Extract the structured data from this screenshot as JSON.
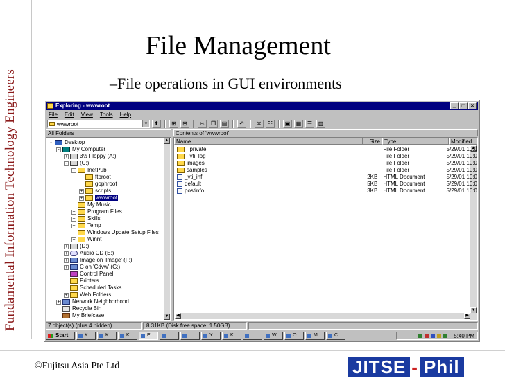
{
  "slide": {
    "title": "File Management",
    "bullet_marker": "–",
    "bullet": "File operations in GUI environments",
    "side_label": "Fundamental Information Technology Engineers",
    "footer_copyright": "©Fujitsu Asia Pte Ltd",
    "logo_left": "JITSE",
    "logo_dash": "-",
    "logo_right": "Phil"
  },
  "window": {
    "title": "Exploring - wwwroot",
    "buttons": {
      "minimize": "_",
      "maximize": "□",
      "close": "×"
    },
    "menu": [
      "File",
      "Edit",
      "View",
      "Tools",
      "Help"
    ],
    "address": "wwwroot",
    "toolbar_icons": [
      "up-folder-icon",
      "map-drive-icon",
      "disconnect-icon",
      "cut-icon",
      "copy-icon",
      "paste-icon",
      "undo-icon",
      "delete-icon",
      "properties-icon",
      "large-icons-icon",
      "small-icons-icon",
      "list-icon",
      "details-icon"
    ],
    "pane_left_header": "All Folders",
    "pane_right_header": "Contents of 'wwwroot'",
    "tree": [
      {
        "label": "Desktop",
        "icon": "desk",
        "toggle": "-",
        "depth": 0
      },
      {
        "label": "My Computer",
        "icon": "comp",
        "toggle": "-",
        "depth": 1
      },
      {
        "label": "3½ Floppy (A:)",
        "icon": "drive",
        "toggle": "+",
        "depth": 2
      },
      {
        "label": "(C:)",
        "icon": "drive",
        "toggle": "-",
        "depth": 2
      },
      {
        "label": "InetPub",
        "icon": "folder",
        "toggle": "-",
        "depth": 3
      },
      {
        "label": "ftproot",
        "icon": "folder",
        "toggle": "",
        "depth": 4
      },
      {
        "label": "gophroot",
        "icon": "folder",
        "toggle": "",
        "depth": 4
      },
      {
        "label": "scripts",
        "icon": "folder",
        "toggle": "+",
        "depth": 4
      },
      {
        "label": "wwwroot",
        "icon": "folder",
        "toggle": "+",
        "depth": 4,
        "selected": true
      },
      {
        "label": "My Music",
        "icon": "folder",
        "toggle": "",
        "depth": 3
      },
      {
        "label": "Program Files",
        "icon": "folder",
        "toggle": "+",
        "depth": 3
      },
      {
        "label": "Skills",
        "icon": "folder",
        "toggle": "+",
        "depth": 3
      },
      {
        "label": "Temp",
        "icon": "folder",
        "toggle": "+",
        "depth": 3
      },
      {
        "label": "Windows Update Setup Files",
        "icon": "folder",
        "toggle": "",
        "depth": 3
      },
      {
        "label": "Winnt",
        "icon": "folder",
        "toggle": "+",
        "depth": 3
      },
      {
        "label": "(D:)",
        "icon": "drive",
        "toggle": "+",
        "depth": 2
      },
      {
        "label": "Audio CD (E:)",
        "icon": "cd",
        "toggle": "+",
        "depth": 2
      },
      {
        "label": "Image on 'Image' (F:)",
        "icon": "net",
        "toggle": "+",
        "depth": 2
      },
      {
        "label": "C on 'Cdvw' (G:)",
        "icon": "net",
        "toggle": "+",
        "depth": 2
      },
      {
        "label": "Control Panel",
        "icon": "cpl",
        "toggle": "",
        "depth": 2
      },
      {
        "label": "Printers",
        "icon": "folder",
        "toggle": "",
        "depth": 2
      },
      {
        "label": "Scheduled Tasks",
        "icon": "folder",
        "toggle": "",
        "depth": 2
      },
      {
        "label": "Web Folders",
        "icon": "folder",
        "toggle": "+",
        "depth": 2
      },
      {
        "label": "Network Neighborhood",
        "icon": "net",
        "toggle": "+",
        "depth": 1
      },
      {
        "label": "Recycle Bin",
        "icon": "bin",
        "toggle": "",
        "depth": 1
      },
      {
        "label": "My Briefcase",
        "icon": "brief",
        "toggle": "",
        "depth": 1
      }
    ],
    "columns": {
      "name": "Name",
      "size": "Size",
      "type": "Type",
      "modified": "Modified"
    },
    "files": [
      {
        "name": "_private",
        "size": "",
        "type": "File Folder",
        "modified": "5/29/01 10:0",
        "icon": "folder"
      },
      {
        "name": "_vti_log",
        "size": "",
        "type": "File Folder",
        "modified": "5/29/01 10:0",
        "icon": "folder"
      },
      {
        "name": "images",
        "size": "",
        "type": "File Folder",
        "modified": "5/29/01 10:0",
        "icon": "folder"
      },
      {
        "name": "samples",
        "size": "",
        "type": "File Folder",
        "modified": "5/29/01 10:0",
        "icon": "folder"
      },
      {
        "name": "_vti_inf",
        "size": "2KB",
        "type": "HTML Document",
        "modified": "5/29/01 10:0",
        "icon": "html"
      },
      {
        "name": "default",
        "size": "5KB",
        "type": "HTML Document",
        "modified": "5/29/01 10:0",
        "icon": "html"
      },
      {
        "name": "postinfo",
        "size": "3KB",
        "type": "HTML Document",
        "modified": "5/29/01 10:0",
        "icon": "html"
      }
    ],
    "status_objects": "7 object(s) (plus 4 hidden)",
    "status_size": "8.31KB (Disk free space: 1.50GB)",
    "taskbar": {
      "start": "Start",
      "tasks": [
        "K...",
        "K...",
        "K...",
        "E...",
        "...",
        "...",
        "Y...",
        "K...",
        "...",
        "W",
        "O...",
        "M...",
        "C..."
      ],
      "active_task_index": 3,
      "clock": "5:40 PM"
    }
  }
}
